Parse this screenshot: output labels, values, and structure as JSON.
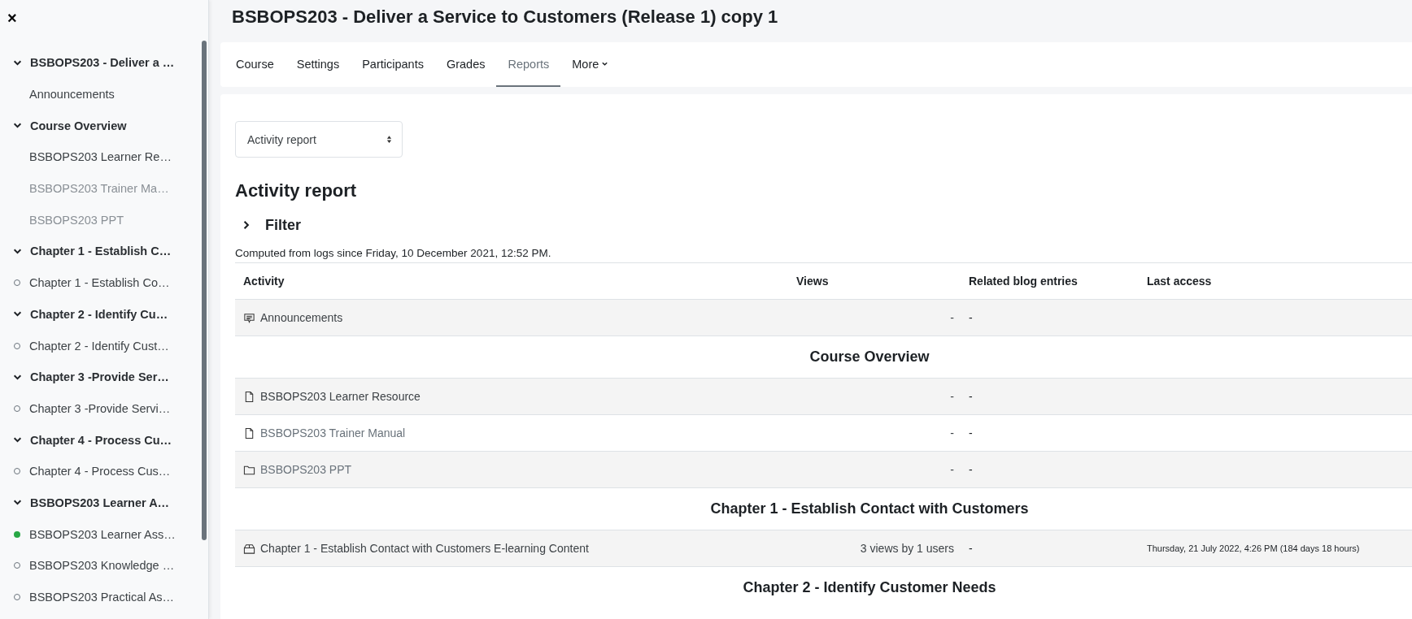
{
  "drawer": {
    "close": "×",
    "sections": [
      {
        "title": "BSBOPS203 - Deliver a …",
        "expanded": true,
        "items": [
          {
            "label": "Announcements",
            "dimmed": false,
            "kind": "plain"
          }
        ]
      },
      {
        "title": "Course Overview",
        "expanded": true,
        "items": [
          {
            "label": "BSBOPS203 Learner Re…",
            "dimmed": false,
            "kind": "plain"
          },
          {
            "label": "BSBOPS203 Trainer Ma…",
            "dimmed": true,
            "kind": "plain"
          },
          {
            "label": "BSBOPS203 PPT",
            "dimmed": true,
            "kind": "plain"
          }
        ]
      },
      {
        "title": "Chapter 1 - Establish C…",
        "expanded": true,
        "items": [
          {
            "label": "Chapter 1 - Establish Co…",
            "dimmed": false,
            "kind": "incomplete"
          }
        ]
      },
      {
        "title": "Chapter 2 - Identify Cu…",
        "expanded": true,
        "items": [
          {
            "label": "Chapter 2 - Identify Cust…",
            "dimmed": false,
            "kind": "incomplete"
          }
        ]
      },
      {
        "title": "Chapter 3 -Provide Ser…",
        "expanded": true,
        "items": [
          {
            "label": "Chapter 3 -Provide Servi…",
            "dimmed": false,
            "kind": "incomplete"
          }
        ]
      },
      {
        "title": "Chapter 4 - Process Cu…",
        "expanded": true,
        "items": [
          {
            "label": "Chapter 4 - Process Cus…",
            "dimmed": false,
            "kind": "incomplete"
          }
        ]
      },
      {
        "title": "BSBOPS203 Learner A…",
        "expanded": true,
        "items": [
          {
            "label": "BSBOPS203 Learner Ass…",
            "dimmed": false,
            "kind": "complete"
          },
          {
            "label": "BSBOPS203 Knowledge …",
            "dimmed": false,
            "kind": "incomplete"
          },
          {
            "label": "BSBOPS203 Practical As…",
            "dimmed": false,
            "kind": "incomplete"
          }
        ]
      }
    ]
  },
  "page_title": "BSBOPS203 - Deliver a Service to Customers (Release 1) copy 1",
  "tabs": [
    {
      "label": "Course",
      "selected": false
    },
    {
      "label": "Settings",
      "selected": false
    },
    {
      "label": "Participants",
      "selected": false
    },
    {
      "label": "Grades",
      "selected": false
    },
    {
      "label": "Reports",
      "selected": true
    },
    {
      "label": "More",
      "selected": false,
      "menu": true
    }
  ],
  "report_select": {
    "value": "Activity report"
  },
  "heading": "Activity report",
  "filter": {
    "label": "Filter",
    "expanded": false
  },
  "computed_note": "Computed from logs since Friday, 10 December 2021, 12:52 PM.",
  "table": {
    "columns": [
      "Activity",
      "Views",
      "Related blog entries",
      "Last access"
    ],
    "rows": [
      {
        "kind": "forum",
        "name": "Announcements",
        "dimmed": false,
        "views": "-",
        "blog": "-"
      },
      {
        "kind": "section",
        "name": "Course Overview"
      },
      {
        "kind": "page",
        "name": "BSBOPS203 Learner Resource",
        "dimmed": false,
        "views": "-",
        "blog": "-"
      },
      {
        "kind": "page",
        "name": "BSBOPS203 Trainer Manual",
        "dimmed": true,
        "views": "-",
        "blog": "-"
      },
      {
        "kind": "folder",
        "name": "BSBOPS203 PPT",
        "dimmed": true,
        "views": "-",
        "blog": "-"
      },
      {
        "kind": "section",
        "name": "Chapter 1 - Establish Contact with Customers"
      },
      {
        "kind": "package",
        "name": "Chapter 1 - Establish Contact with Customers E-learning Content",
        "dimmed": false,
        "views": "3 views by 1 users",
        "blog": "-",
        "last_access": "Thursday, 21 July 2022, 4:26 PM (184 days 18 hours)"
      },
      {
        "kind": "section",
        "name": "Chapter 2 - Identify Customer Needs"
      }
    ]
  }
}
